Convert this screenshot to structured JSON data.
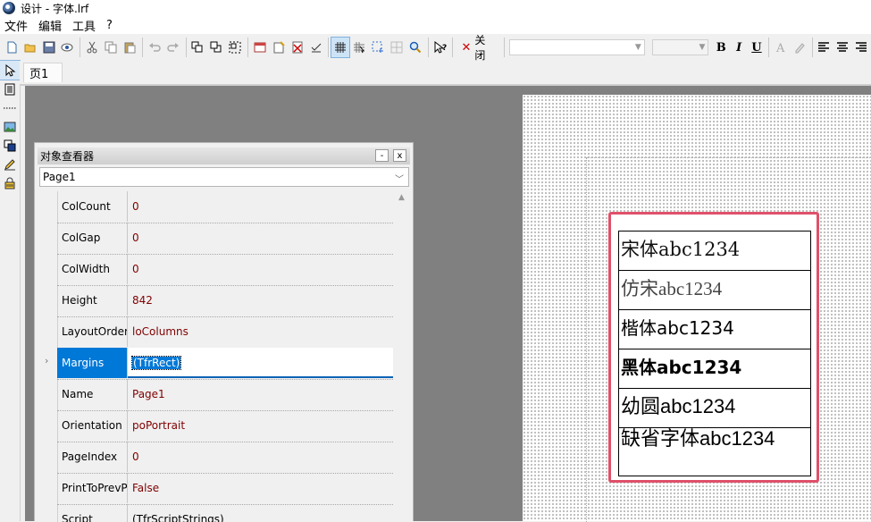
{
  "window": {
    "title": "设计 - 字体.lrf"
  },
  "menu": [
    "文件",
    "编辑",
    "工具",
    "?"
  ],
  "toolbar": {
    "close_label": "关闭",
    "bold": "B",
    "italic": "I",
    "underline": "U"
  },
  "tabs": [
    {
      "label": "页1"
    }
  ],
  "inspector": {
    "title": "对象查看器",
    "minimize": "-",
    "close": "x",
    "selected_object": "Page1",
    "properties": [
      {
        "name": "ColCount",
        "value": "0"
      },
      {
        "name": "ColGap",
        "value": "0"
      },
      {
        "name": "ColWidth",
        "value": "0"
      },
      {
        "name": "Height",
        "value": "842"
      },
      {
        "name": "LayoutOrder",
        "value": "loColumns"
      },
      {
        "name": "Margins",
        "value": "(TfrRect)"
      },
      {
        "name": "Name",
        "value": "Page1"
      },
      {
        "name": "Orientation",
        "value": "poPortrait"
      },
      {
        "name": "PageIndex",
        "value": "0"
      },
      {
        "name": "PrintToPrevP",
        "value": "False"
      },
      {
        "name": "Script",
        "value": "(TfrScriptStrings)"
      }
    ]
  },
  "report_cells": [
    "宋体abc1234",
    "仿宋abc1234",
    "楷体abc1234",
    "黑体abc1234",
    "幼圆abc1234",
    "缺省字体abc1234"
  ]
}
